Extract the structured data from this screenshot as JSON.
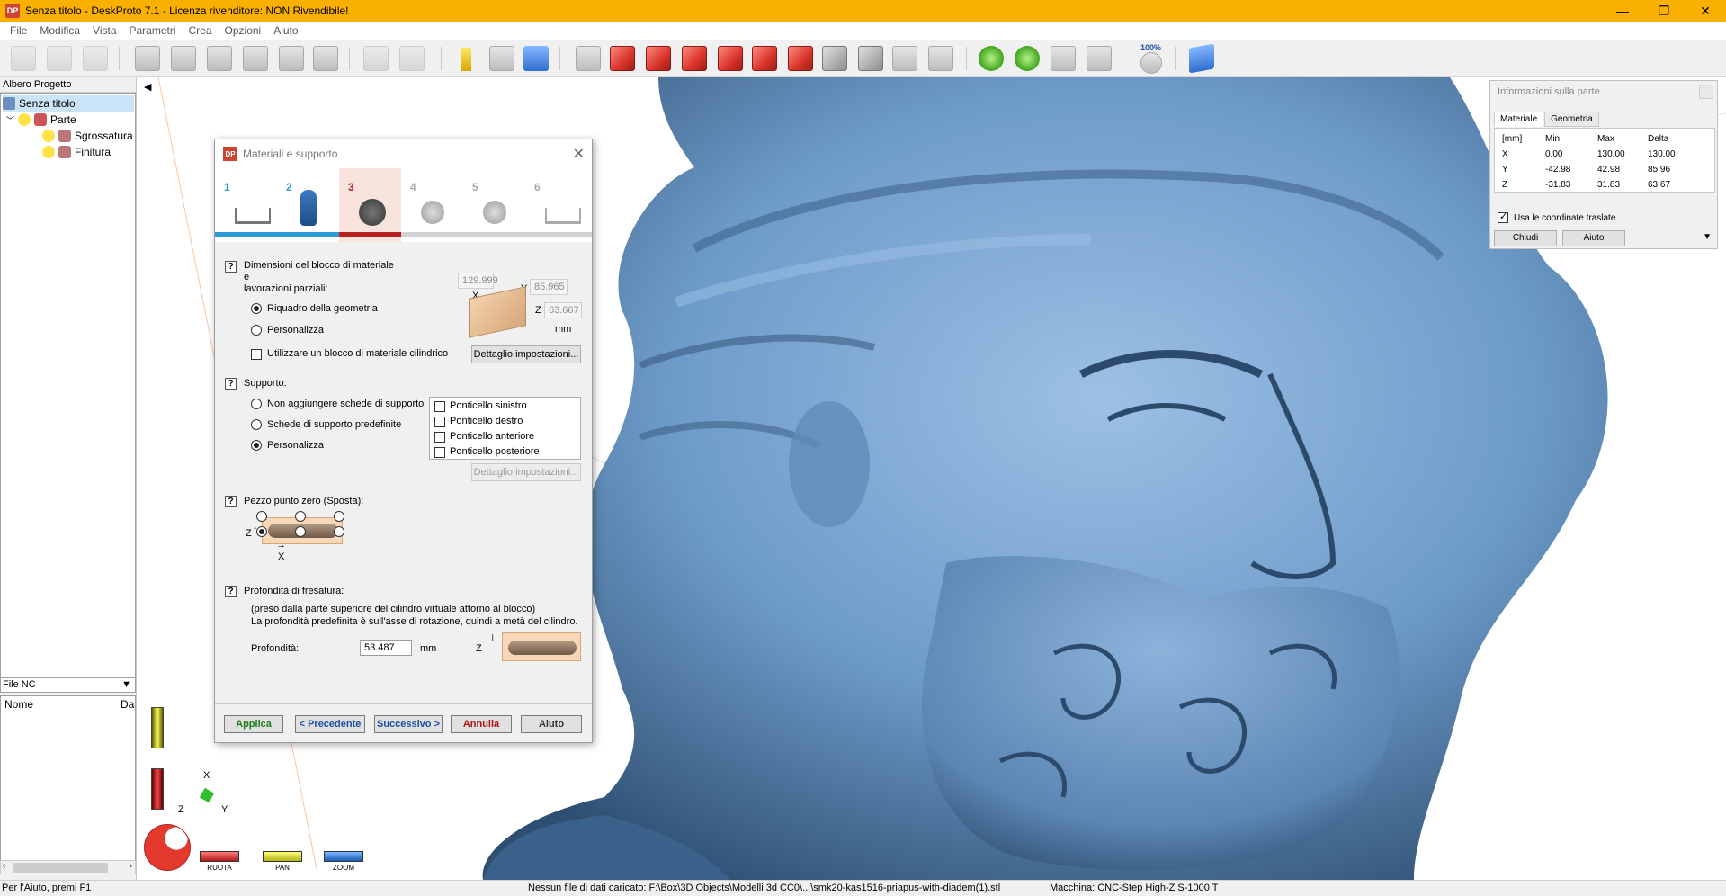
{
  "window": {
    "title": "Senza titolo - DeskProto 7.1 - Licenza rivenditore: NON Rivendibile!",
    "app_icon": "DP",
    "controls": [
      "—",
      "❐",
      "✕"
    ]
  },
  "menu": [
    "File",
    "Modifica",
    "Vista",
    "Parametri",
    "Crea",
    "Opzioni",
    "Aiuto"
  ],
  "toolbar": {
    "zoom_label": "100%"
  },
  "project_tree": {
    "header": "Albero Progetto",
    "items": [
      {
        "label": "Senza titolo"
      },
      {
        "label": "Parte"
      },
      {
        "label": "Sgrossatura"
      },
      {
        "label": "Finitura"
      }
    ]
  },
  "nc_files": {
    "selector": "File NC",
    "columns": [
      "Nome",
      "Da"
    ]
  },
  "dialog": {
    "title": "Materiali e supporto",
    "steps": [
      "1",
      "2",
      "3",
      "4",
      "5",
      "6"
    ],
    "active_step": 3,
    "section1": {
      "q": "?",
      "title_l1": "Dimensioni del blocco di materiale",
      "title_l2": "e",
      "title_l3": "lavorazioni parziali:",
      "opt_geometry": "Riquadro della geometria",
      "opt_custom": "Personalizza",
      "cylindrical": "Utilizzare un blocco di materiale cilindrico",
      "details": "Dettaglio impostazioni...",
      "x_label": "X",
      "y_label": "Y",
      "z_label": "Z",
      "x_value": "129.999",
      "y_value": "85.965",
      "z_value": "63.667",
      "unit": "mm"
    },
    "section2": {
      "q": "?",
      "title": "Supporto:",
      "opt_none": "Non aggiungere schede di supporto",
      "opt_predef": "Schede di supporto predefinite",
      "opt_custom": "Personalizza",
      "bridges": [
        "Ponticello sinistro",
        "Ponticello destro",
        "Ponticello anteriore",
        "Ponticello posteriore"
      ],
      "details": "Dettaglio impostazioni..."
    },
    "section3": {
      "q": "?",
      "title": "Pezzo punto zero  (Sposta):",
      "z": "Z",
      "x": "X"
    },
    "section4": {
      "q": "?",
      "title": "Profondità di fresatura:",
      "note1": "(preso dalla parte superiore del cilindro virtuale attorno al blocco)",
      "note2": "La profondità predefinita è sull'asse di rotazione, quindi a metà del cilindro.",
      "depth_label": "Profondità:",
      "depth_value": "53.487",
      "unit": "mm",
      "z": "Z"
    },
    "buttons": {
      "apply": "Applica",
      "prev": "< Precedente",
      "next": "Successivo >",
      "cancel": "Annulla",
      "help": "Aiuto"
    },
    "colors": {
      "apply": "#1c7a1c",
      "nav": "#1f4fa0",
      "cancel": "#b01212",
      "step_active": "#b52020",
      "step_done": "#2d9bd6"
    }
  },
  "info_panel": {
    "title": "Informazioni sulla parte",
    "tabs": [
      "Materiale",
      "Geometria"
    ],
    "headers": [
      "[mm]",
      "Min",
      "Max",
      "Delta"
    ],
    "rows": [
      {
        "axis": "X",
        "min": "0.00",
        "max": "130.00",
        "delta": "130.00"
      },
      {
        "axis": "Y",
        "min": "-42.98",
        "max": "42.98",
        "delta": "85.96"
      },
      {
        "axis": "Z",
        "min": "-31.83",
        "max": "31.83",
        "delta": "63.67"
      }
    ],
    "checkbox": "Usa le coordinate traslate",
    "close": "Chiudi",
    "help": "Aiuto"
  },
  "viewport": {
    "axes": {
      "x": "X",
      "y": "Y",
      "z": "Z"
    },
    "modes": [
      "RUOTA",
      "PAN",
      "ZOOM"
    ],
    "model_color": "#6d9bc9"
  },
  "status": {
    "help": "Per l'Aiuto, premi F1",
    "file": "Nessun file di dati caricato: F:\\Box\\3D Objects\\Modelli 3d CC0\\...\\smk20-kas1516-priapus-with-diadem(1).stl",
    "machine": "Macchina: CNC-Step High-Z S-1000 T"
  }
}
